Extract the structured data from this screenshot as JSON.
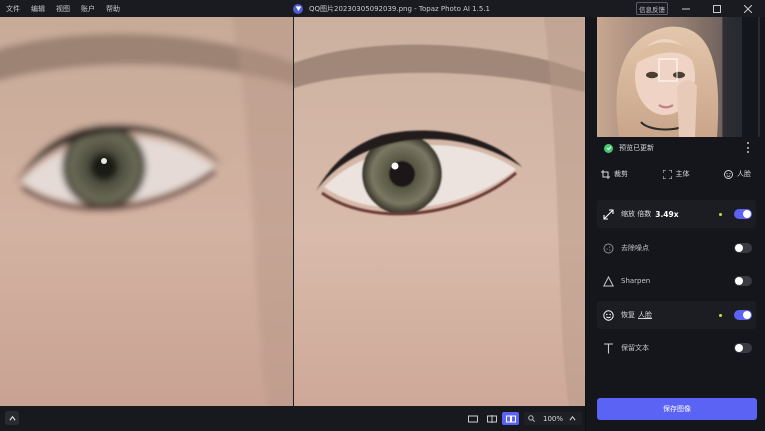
{
  "menu": [
    "文件",
    "编辑",
    "视图",
    "账户",
    "帮助"
  ],
  "window": {
    "title": "QQ图片20230305092039.png - Topaz Photo AI 1.5.1",
    "feedback_label": "信息反馈"
  },
  "zoom": {
    "value": "100%"
  },
  "side": {
    "preview_status": "预览已更新",
    "tools": [
      {
        "label": "裁剪",
        "icon": "crop-icon"
      },
      {
        "label": "主体",
        "icon": "subject-icon"
      },
      {
        "label": "人脸",
        "icon": "face-icon"
      }
    ],
    "enhancements": [
      {
        "label": "缩放 倍数",
        "value": "3.49x",
        "enabled": true,
        "icon": "upscale-icon"
      },
      {
        "label": "去除噪点",
        "enabled": false,
        "icon": "denoise-icon"
      },
      {
        "label": "Sharpen",
        "enabled": false,
        "icon": "sharpen-icon"
      },
      {
        "label": "恢复",
        "link": "人脸",
        "enabled": true,
        "icon": "face-recovery-icon"
      },
      {
        "label": "保留文本",
        "enabled": false,
        "icon": "text-icon"
      }
    ],
    "save_label": "保存图像"
  },
  "colors": {
    "accent": "#5b63f5",
    "status_ok": "#48c774",
    "active_dot": "#b7e34a",
    "panel_bg": "#15161b"
  }
}
